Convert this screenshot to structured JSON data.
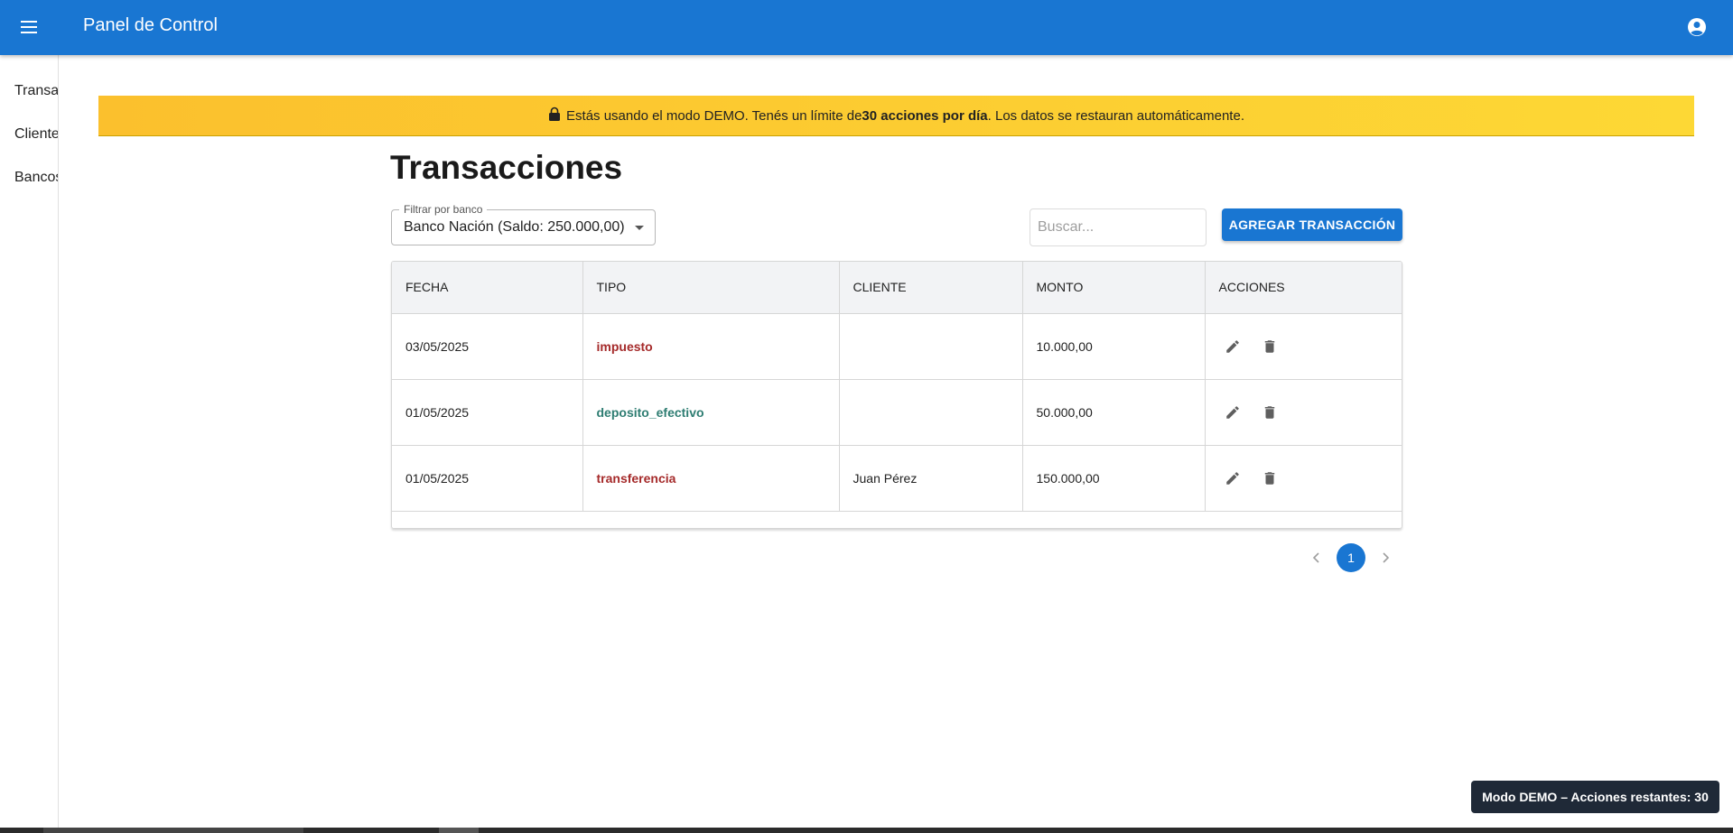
{
  "appbar": {
    "title": "Panel de Control",
    "color": "#1976d2"
  },
  "sidebar": {
    "items": [
      {
        "label": "Transacciones"
      },
      {
        "label": "Clientes"
      },
      {
        "label": "Bancos"
      }
    ]
  },
  "banner": {
    "pre": "Estás usando el modo DEMO. Tenés un límite de ",
    "bold": "30 acciones por día",
    "post": ". Los datos se restauran automáticamente.",
    "icon": "lock-icon"
  },
  "page": {
    "title": "Transacciones"
  },
  "filter": {
    "label": "Filtrar por banco",
    "value": "Banco Nación (Saldo: 250.000,00)"
  },
  "search": {
    "placeholder": "Buscar..."
  },
  "actions": {
    "add_label": "AGREGAR TRANSACCIÓN"
  },
  "table": {
    "columns": [
      "FECHA",
      "TIPO",
      "CLIENTE",
      "MONTO",
      "ACCIONES"
    ],
    "rows": [
      {
        "fecha": "03/05/2025",
        "tipo": "impuesto",
        "tipo_color": "red",
        "cliente": "",
        "monto": "10.000,00"
      },
      {
        "fecha": "01/05/2025",
        "tipo": "deposito_efectivo",
        "tipo_color": "green",
        "cliente": "",
        "monto": "50.000,00"
      },
      {
        "fecha": "01/05/2025",
        "tipo": "transferencia",
        "tipo_color": "red",
        "cliente": "Juan Pérez",
        "monto": "150.000,00"
      }
    ]
  },
  "pagination": {
    "current_page": "1"
  },
  "toast": {
    "text": "Modo DEMO – Acciones restantes: 30"
  }
}
